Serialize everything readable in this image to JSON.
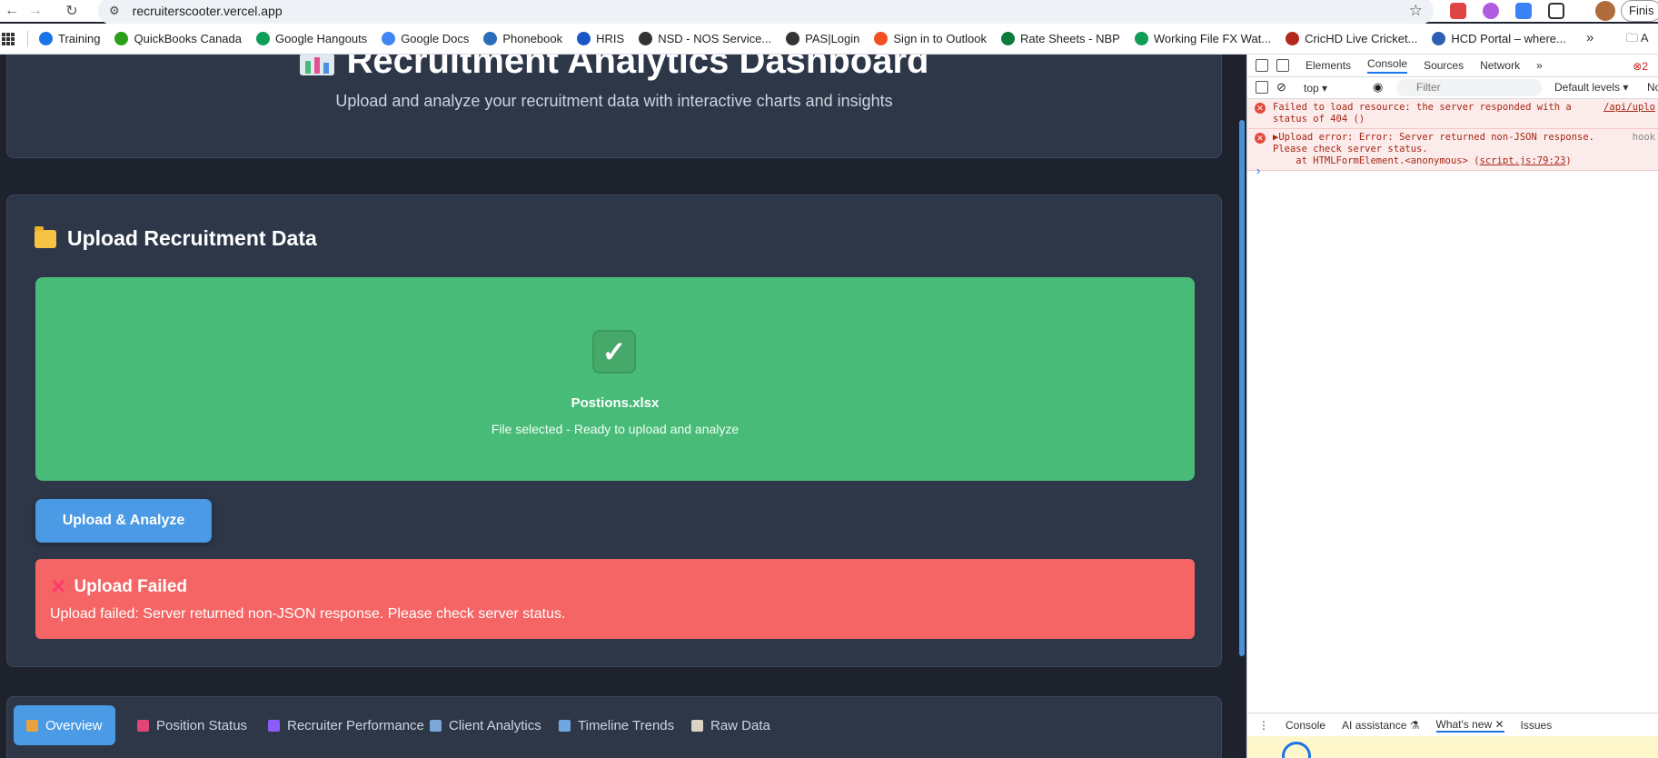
{
  "browser": {
    "url": "recruiterscooter.vercel.app",
    "profile_button": "Finis",
    "bookmarks": [
      {
        "label": "Training",
        "icon": "training-icon",
        "color": "#1a73e8"
      },
      {
        "label": "QuickBooks Canada",
        "icon": "quickbooks-icon",
        "color": "#2ca01c"
      },
      {
        "label": "Google Hangouts",
        "icon": "hangouts-icon",
        "color": "#0f9d58"
      },
      {
        "label": "Google Docs",
        "icon": "docs-icon",
        "color": "#4285f4"
      },
      {
        "label": "Phonebook",
        "icon": "phonebook-icon",
        "color": "#2a6ebb"
      },
      {
        "label": "HRIS",
        "icon": "hris-icon",
        "color": "#1a56c4"
      },
      {
        "label": "NSD - NOS Service...",
        "icon": "globe-icon",
        "color": "#333333"
      },
      {
        "label": "PAS|Login",
        "icon": "globe-icon",
        "color": "#333333"
      },
      {
        "label": "Sign in to Outlook",
        "icon": "microsoft-icon",
        "color": "#f25022"
      },
      {
        "label": "Rate Sheets - NBP",
        "icon": "nbp-icon",
        "color": "#0b7a3b"
      },
      {
        "label": "Working File FX Wat...",
        "icon": "sheets-icon",
        "color": "#0f9d58"
      },
      {
        "label": "CricHD Live Cricket...",
        "icon": "cricket-icon",
        "color": "#b0281e"
      },
      {
        "label": "HCD Portal – where...",
        "icon": "hcd-icon",
        "color": "#2b5fb4"
      }
    ],
    "bookmarks_more": "»",
    "all_bookmarks": "A"
  },
  "page": {
    "hero_title": "Recruitment Analytics Dashboard",
    "hero_subtitle": "Upload and analyze your recruitment data with interactive charts and insights",
    "upload_heading": "Upload Recruitment Data",
    "file_name": "Postions.xlsx",
    "file_status": "File selected - Ready to upload and analyze",
    "upload_button": "Upload & Analyze",
    "error_title": "Upload Failed",
    "error_message": "Upload failed: Server returned non-JSON response. Please check server status.",
    "tabs": [
      {
        "label": "Overview",
        "color": "#e8a33d"
      },
      {
        "label": "Position Status",
        "color": "#e0457b"
      },
      {
        "label": "Recruiter Performance",
        "color": "#8b5cf6"
      },
      {
        "label": "Client Analytics",
        "color": "#7aa7d6"
      },
      {
        "label": "Timeline Trends",
        "color": "#6fa8e0"
      },
      {
        "label": "Raw Data",
        "color": "#d9d2c5"
      }
    ]
  },
  "devtools": {
    "tabs": [
      "Elements",
      "Console",
      "Sources",
      "Network"
    ],
    "more": "»",
    "error_count": "2",
    "context": "top ▾",
    "filter_placeholder": "Filter",
    "levels": "Default levels ▾",
    "levels_extra": "No",
    "logs": [
      {
        "text": "Failed to load resource: the server responded with a\nstatus of 404 ()",
        "source": "/api/uplo"
      },
      {
        "text": "▶Upload error: Error: Server returned non-JSON response.\nPlease check server status.\n    at HTMLFormElement.<anonymous> (",
        "link": "script.js:79:23",
        "after": ")",
        "source": "hook"
      }
    ],
    "prompt": "›",
    "drawer_tabs": [
      "Console",
      "AI assistance ⚗",
      "What's new ✕",
      "Issues"
    ]
  }
}
